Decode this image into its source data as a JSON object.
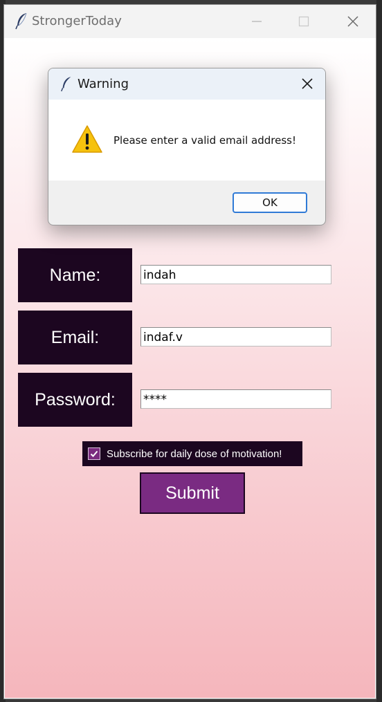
{
  "window": {
    "title": "StrongerToday",
    "icon": "feather-icon"
  },
  "form": {
    "name_label": "Name:",
    "name_value": "indah",
    "email_label": "Email:",
    "email_value": "indaf.v",
    "password_label": "Password:",
    "password_value": "****",
    "subscribe_label": "Subscribe for daily dose of motivation!",
    "subscribe_checked": true,
    "submit_label": "Submit"
  },
  "dialog": {
    "title": "Warning",
    "icon": "warning-icon",
    "message": "Please enter a valid email address!",
    "ok_label": "OK"
  },
  "colors": {
    "label_bg": "#1c0620",
    "submit_bg": "#7a2b82",
    "gradient_bottom": "#f5b6bc",
    "dialog_focus": "#2f7ad6"
  }
}
